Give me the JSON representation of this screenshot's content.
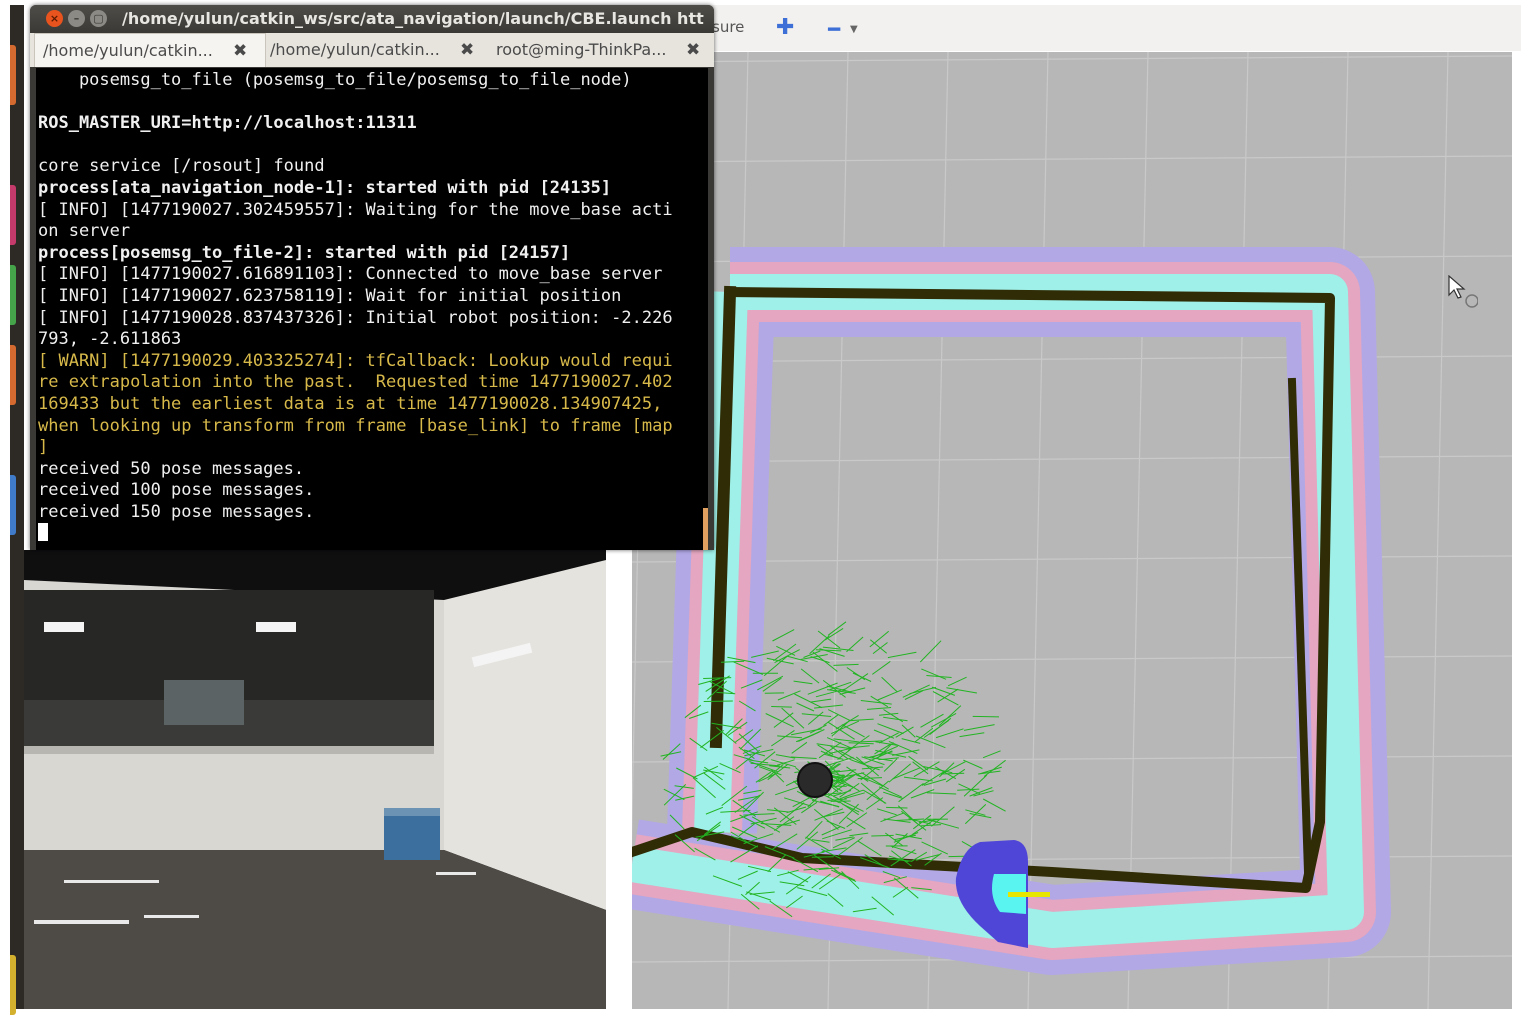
{
  "terminal": {
    "title": "/home/yulun/catkin_ws/src/ata_navigation/launch/CBE.launch htt",
    "tabs": [
      {
        "label": "/home/yulun/catkin..."
      },
      {
        "label": "/home/yulun/catkin..."
      },
      {
        "label": "root@ming-ThinkPa..."
      }
    ],
    "lines": [
      {
        "text": "    posemsg_to_file (posemsg_to_file/posemsg_to_file_node)",
        "style": ""
      },
      {
        "text": "",
        "style": ""
      },
      {
        "text": "ROS_MASTER_URI=http://localhost:11311",
        "style": "b"
      },
      {
        "text": "",
        "style": ""
      },
      {
        "text": "core service [/rosout] found",
        "style": ""
      },
      {
        "text": "process[ata_navigation_node-1]: started with pid [24135]",
        "style": "b"
      },
      {
        "text": "[ INFO] [1477190027.302459557]: Waiting for the move_base acti",
        "style": ""
      },
      {
        "text": "on server",
        "style": ""
      },
      {
        "text": "process[posemsg_to_file-2]: started with pid [24157]",
        "style": "b"
      },
      {
        "text": "[ INFO] [1477190027.616891103]: Connected to move_base server",
        "style": ""
      },
      {
        "text": "[ INFO] [1477190027.623758119]: Wait for initial position",
        "style": ""
      },
      {
        "text": "[ INFO] [1477190028.837437326]: Initial robot position: -2.226",
        "style": ""
      },
      {
        "text": "793, -2.611863",
        "style": ""
      },
      {
        "text": "[ WARN] [1477190029.403325274]: tfCallback: Lookup would requi",
        "style": "warn"
      },
      {
        "text": "re extrapolation into the past.  Requested time 1477190027.402",
        "style": "warn"
      },
      {
        "text": "169433 but the earliest data is at time 1477190028.134907425,",
        "style": "warn"
      },
      {
        "text": "when looking up transform from frame [base_link] to frame [map",
        "style": "warn"
      },
      {
        "text": "]",
        "style": "warn"
      },
      {
        "text": "received 50 pose messages.",
        "style": ""
      },
      {
        "text": "received 100 pose messages.",
        "style": ""
      },
      {
        "text": "received 150 pose messages.",
        "style": ""
      }
    ]
  },
  "rviz": {
    "toolbar": {
      "measure_label": "sure",
      "add_icon": "plus-icon",
      "remove_icon": "minus-icon"
    },
    "colors": {
      "background": "#b7b7b7",
      "grid": "#c9c9c9",
      "inflation_outer": "#b2a8e6",
      "inflation_pink": "#e4a6c0",
      "inflation_cyan": "#9ff0e8",
      "wall": "#302c05",
      "particle": "#22b422",
      "robot": "#2a2a2a",
      "sensor_blue": "#4f46d8",
      "sensor_cyan": "#59f4f0"
    }
  },
  "camera": {
    "description_icon": "camera-feed"
  }
}
